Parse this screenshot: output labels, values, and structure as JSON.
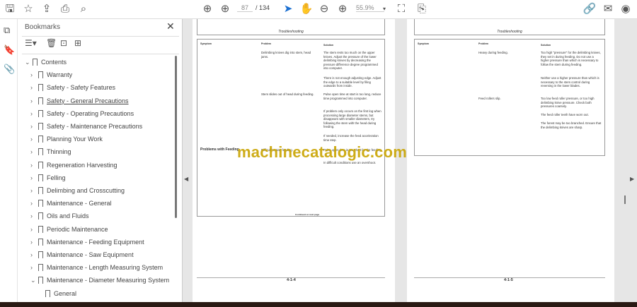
{
  "toolbar": {
    "page_current": "87",
    "page_total": "/ 134",
    "zoom": "55.9%"
  },
  "panel": {
    "title": "Bookmarks"
  },
  "bookmarks": [
    {
      "label": "Contents",
      "expanded": true
    },
    {
      "label": "Warranty"
    },
    {
      "label": "Safety - Safety Features"
    },
    {
      "label": "Safety - General Precautions"
    },
    {
      "label": "Safety - Operating Precautions"
    },
    {
      "label": "Safety - Maintenance Precautions"
    },
    {
      "label": "Planning Your Work"
    },
    {
      "label": "Thinning"
    },
    {
      "label": "Regeneration Harvesting"
    },
    {
      "label": "Felling"
    },
    {
      "label": "Delimbing and Crosscutting"
    },
    {
      "label": "Maintenance - General"
    },
    {
      "label": "Oils and Fluids"
    },
    {
      "label": "Periodic Maintenance"
    },
    {
      "label": "Maintenance - Feeding Equipment"
    },
    {
      "label": "Maintenance - Saw Equipment"
    },
    {
      "label": "Maintenance - Length Measuring System"
    },
    {
      "label": "Maintenance - Diameter Measuring System",
      "expanded": true
    },
    {
      "label": "General"
    }
  ],
  "left_page": {
    "header": "Troubleshooting",
    "col_symptom": "Symptom",
    "col_problem": "Problem",
    "col_solution": "Solution",
    "p1": "Delimbing knives dig into stem, head jams.",
    "s1a": "The stem rests too much on the upper knives. Adjust the pressure of the lower delimbing knives by decreasing the pressure difference degree programmed into computer.",
    "s1b": "There is not enough adjusting edge. Adjust the edge to a suitable level by filing outwards from inside.",
    "p2": "Stem slides out of head during feeding.",
    "s2a": "Pulse open time at start is too long, reduce time programmed into computer.",
    "s2b": "If problem only occurs on the first log when processing large diameter stems, but disappears with smaller diameters, try following the stem with the head during feeding.",
    "s2c": "If needed, increase the feed acceleration time step.",
    "symptom2": "Problems with Feeding",
    "p3": "Difficult to start feeding.",
    "s3a": "Pulse open time is too short for the feeding.",
    "s3b": "In difficult conditions use an overshoot.",
    "continued": "Continued on next page",
    "page_number": "4-1-4"
  },
  "right_page": {
    "header": "Troubleshooting",
    "col_symptom": "Symptom",
    "col_problem": "Problem",
    "col_solution": "Solution",
    "p1": "Heavy during feeding.",
    "s1a": "Too high \"pressure\" for the delimbing knives, they set in during feeding. Do not use a higher pressure than which is necessary to follow the stem during feeding.",
    "s1b": "Neither use a higher pressure than which is necessary to the stem control during reversing in the lower blades.",
    "p2": "Feed rollers slip.",
    "s2a": "Too low feed roller pressure, or too high delimbing knive pressure. Check both pressures coarsely.",
    "s2b": "The feed roller teeth have worn out.",
    "s2c": "The forest may be too branched. Ensure that the delimbing knives are sharp.",
    "page_number": "4-1-5"
  },
  "watermark": "machinecatalogic.com"
}
